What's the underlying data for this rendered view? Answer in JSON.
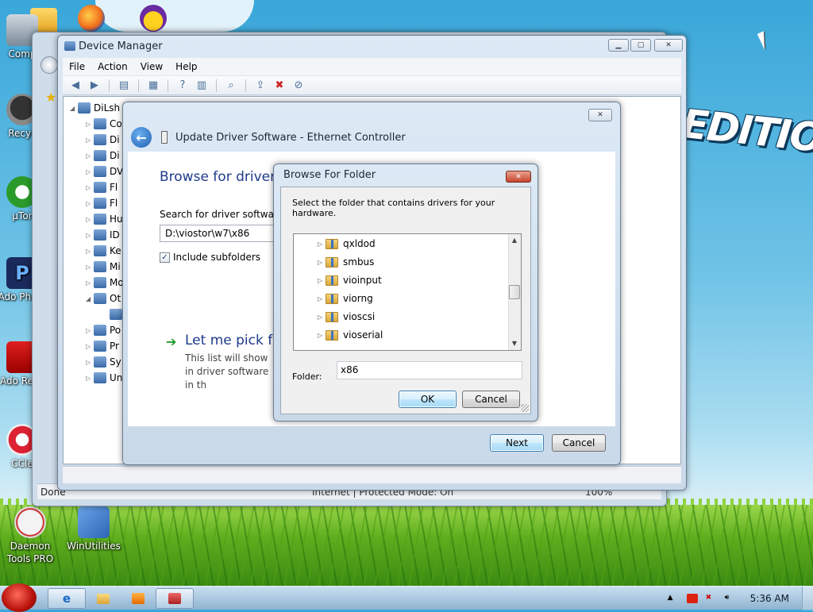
{
  "desktop": {
    "icons": [
      {
        "label": "Comp",
        "icon": "computer-icon"
      },
      {
        "label": "Recyc",
        "icon": "recycle-bin-icon"
      },
      {
        "label": "µTor",
        "icon": "utorrent-icon"
      },
      {
        "label": "Ado Photo",
        "icon": "photoshop-icon"
      },
      {
        "label": "Ado Reac",
        "icon": "acrobat-icon"
      },
      {
        "label": "CCle",
        "icon": "ccleaner-icon"
      },
      {
        "label": "Daemon Tools PRO",
        "icon": "daemon-tools-icon"
      },
      {
        "label": "WinUtilities",
        "icon": "winutilities-icon"
      }
    ],
    "wallpaper_text": "EDITION"
  },
  "ie_window": {
    "status_text": "Done",
    "zone_text": "Internet | Protected Mode: On",
    "zoom_text": "100%"
  },
  "device_manager": {
    "title": "Device Manager",
    "menu": [
      "File",
      "Action",
      "View",
      "Help"
    ],
    "tree_root": "DiLsh",
    "tree_items": [
      "Co",
      "Di",
      "Di",
      "DV",
      "Fl",
      "Fl",
      "Hu",
      "ID",
      "Ke",
      "Mi",
      "Mo",
      "Ot",
      "",
      "Po",
      "Pr",
      "Sy",
      "Un"
    ]
  },
  "update_driver": {
    "title": "Update Driver Software - Ethernet Controller",
    "heading": "Browse for driver so",
    "search_label": "Search for driver software in",
    "path_value": "D:\\viostor\\w7\\x86",
    "include_subfolders_label": "Include subfolders",
    "include_subfolders_checked": true,
    "pick_title": "Let me pick fro",
    "pick_desc": "This list will show in driver software in th",
    "next_label": "Next",
    "cancel_label": "Cancel"
  },
  "browse_folder": {
    "title": "Browse For Folder",
    "prompt": "Select the folder that contains drivers for your hardware.",
    "folders": [
      "qxldod",
      "smbus",
      "vioinput",
      "viorng",
      "vioscsi",
      "vioserial"
    ],
    "folder_label": "Folder:",
    "folder_value": "x86",
    "ok_label": "OK",
    "cancel_label": "Cancel"
  },
  "taskbar": {
    "clock": "5:36 AM"
  },
  "colors": {
    "accent_link": "#1e3a8a",
    "close_button": "#c8452d",
    "default_button": "#3c7fb1"
  }
}
